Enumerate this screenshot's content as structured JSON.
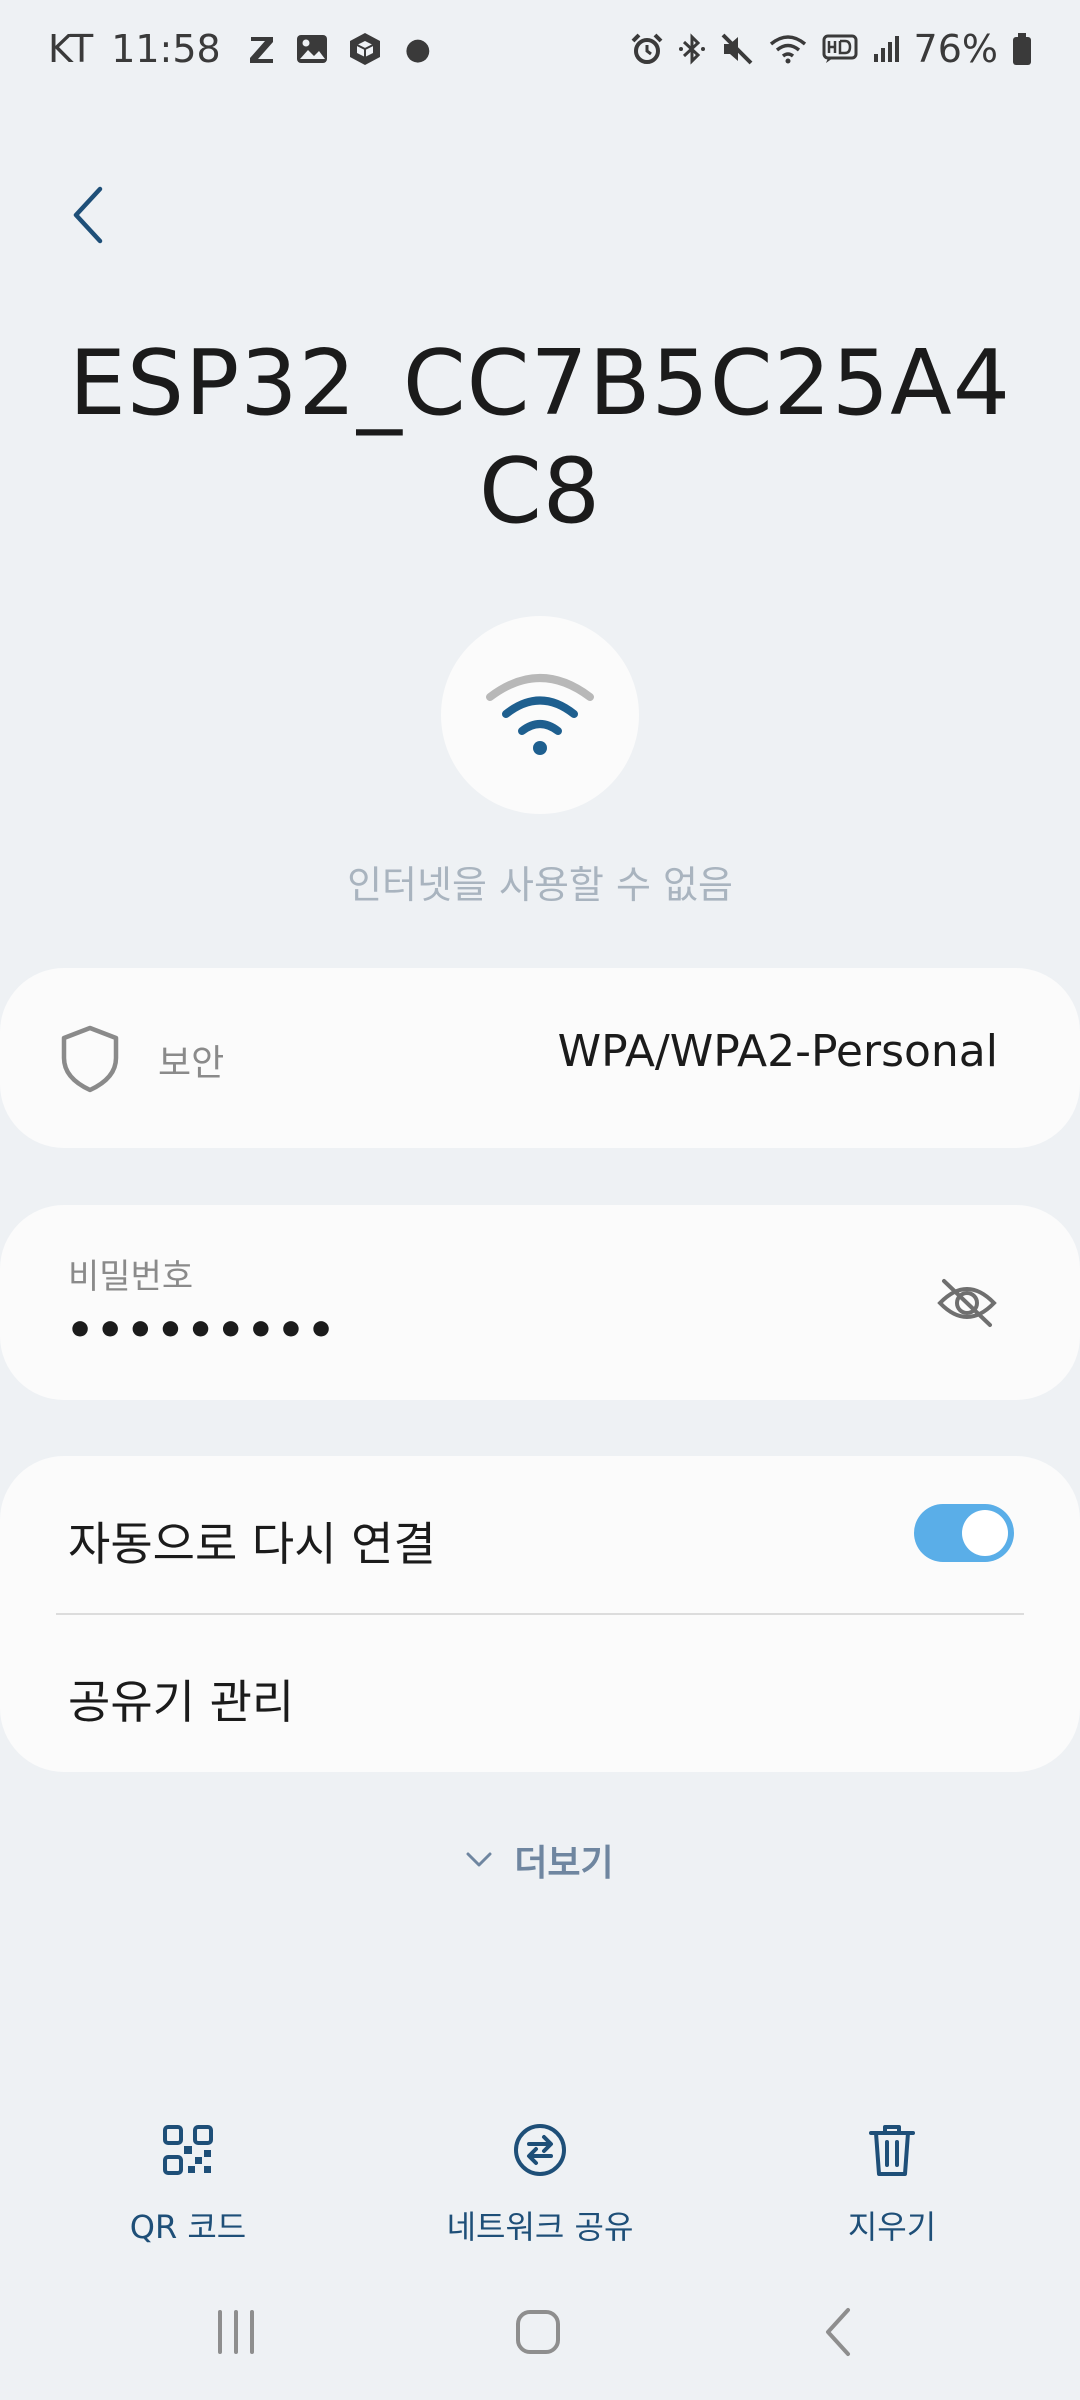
{
  "status_bar": {
    "carrier": "KT",
    "time": "11:58",
    "battery_percent": "76%",
    "left_icons": [
      "z-icon",
      "gallery-icon",
      "cube-icon",
      "dot-icon"
    ],
    "right_icons": [
      "alarm-icon",
      "bluetooth-icon",
      "mute-icon",
      "wifi-icon",
      "hd-icon",
      "signal-icon",
      "battery-icon"
    ]
  },
  "header": {
    "network_name": "ESP32_CC7B5C25A4C8"
  },
  "wifi_status": {
    "icon": "wifi-icon",
    "status_text": "인터넷을 사용할 수 없음"
  },
  "security": {
    "label": "보안",
    "value": "WPA/WPA2-Personal"
  },
  "password": {
    "label": "비밀번호",
    "masked_value": "•••••••••"
  },
  "settings": {
    "auto_reconnect_label": "자동으로 다시 연결",
    "auto_reconnect_enabled": true,
    "router_management_label": "공유기 관리"
  },
  "more": {
    "label": "더보기"
  },
  "actions": {
    "qr_label": "QR 코드",
    "share_label": "네트워크 공유",
    "delete_label": "지우기"
  },
  "colors": {
    "background": "#eef1f4",
    "card": "#fbfbfb",
    "accent": "#1e5f8f",
    "toggle_on": "#5aaee8",
    "action_text": "#1e4f78"
  }
}
